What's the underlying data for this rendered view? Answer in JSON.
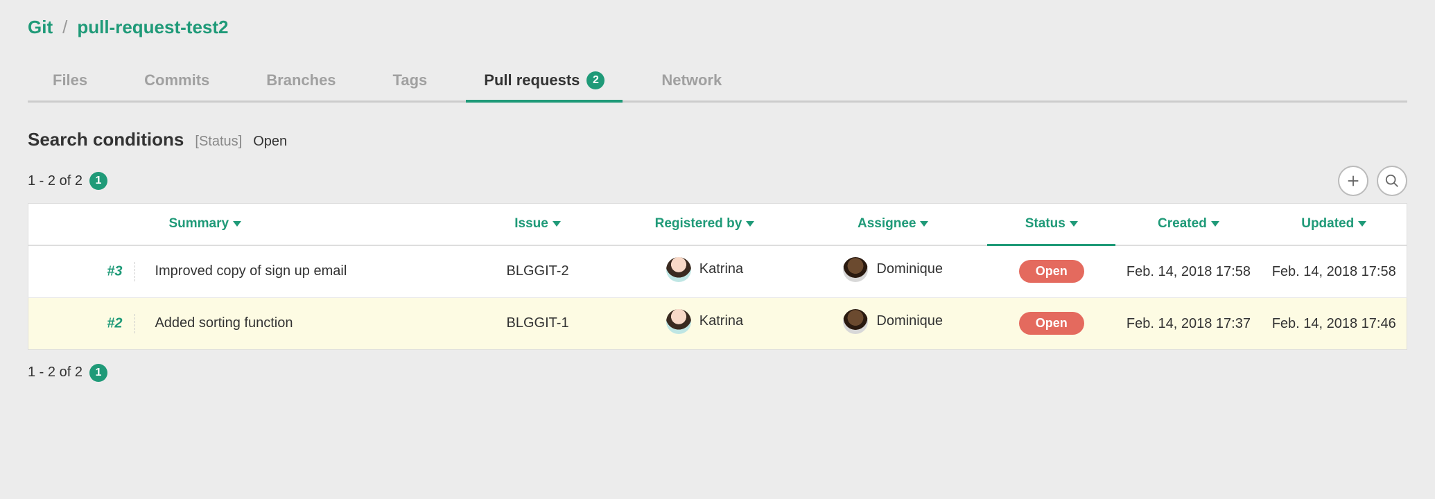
{
  "breadcrumb": {
    "root": "Git",
    "repo": "pull-request-test2"
  },
  "tabs": {
    "files": "Files",
    "commits": "Commits",
    "branches": "Branches",
    "tags": "Tags",
    "pull_requests": "Pull requests",
    "pull_requests_count": "2",
    "network": "Network"
  },
  "search": {
    "title": "Search conditions",
    "status_label": "[Status]",
    "status_value": "Open"
  },
  "range_top": {
    "text": "1 - 2 of 2",
    "badge": "1"
  },
  "range_bottom": {
    "text": "1 - 2 of 2",
    "badge": "1"
  },
  "columns": {
    "summary": "Summary",
    "issue": "Issue",
    "registered_by": "Registered by",
    "assignee": "Assignee",
    "status": "Status",
    "created": "Created",
    "updated": "Updated"
  },
  "rows": [
    {
      "num": "#3",
      "summary": "Improved copy of sign up email",
      "issue": "BLGGIT-2",
      "registered_by": "Katrina",
      "assignee": "Dominique",
      "status": "Open",
      "created": "Feb. 14, 2018 17:58",
      "updated": "Feb. 14, 2018 17:58"
    },
    {
      "num": "#2",
      "summary": "Added sorting function",
      "issue": "BLGGIT-1",
      "registered_by": "Katrina",
      "assignee": "Dominique",
      "status": "Open",
      "created": "Feb. 14, 2018 17:37",
      "updated": "Feb. 14, 2018 17:46"
    }
  ]
}
